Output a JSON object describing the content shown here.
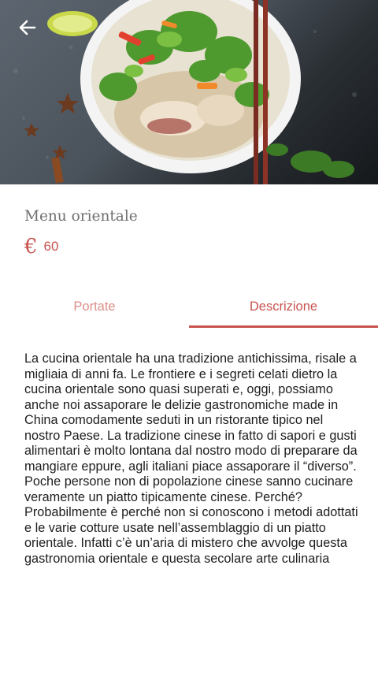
{
  "header": {
    "back_icon": "arrow-left-icon"
  },
  "product": {
    "title": "Menu orientale",
    "currency_icon": "euro-icon",
    "currency_symbol": "€",
    "price": "60"
  },
  "tabs": [
    {
      "label": "Portate",
      "active": false
    },
    {
      "label": "Descrizione",
      "active": true
    }
  ],
  "description": "La cucina orientale ha una tradizione antichissima, risale a migliaia di anni fa. Le frontiere e i segreti celati dietro la cucina orientale sono quasi superati e, oggi, possiamo anche noi assaporare le delizie gastronomiche made in China comodamente seduti in un ristorante tipico nel nostro Paese. La tradizione cinese in fatto di sapori e gusti alimentari è molto lontana dal nostro modo di preparare da mangiare eppure, agli italiani piace assaporare il “diverso”. Poche persone non di popolazione cinese sanno cucinare veramente un piatto tipicamente cinese. Perché? Probabilmente è perché non si conoscono i metodi adottati e le varie cotture usate nell’assemblaggio di un piatto orientale. Infatti c’è un’aria di mistero che avvolge questa gastronomia orientale e questa secolare arte culinaria",
  "colors": {
    "accent": "#c8534f",
    "tab_inactive": "#dc8f89",
    "title": "#6f6f6f"
  }
}
